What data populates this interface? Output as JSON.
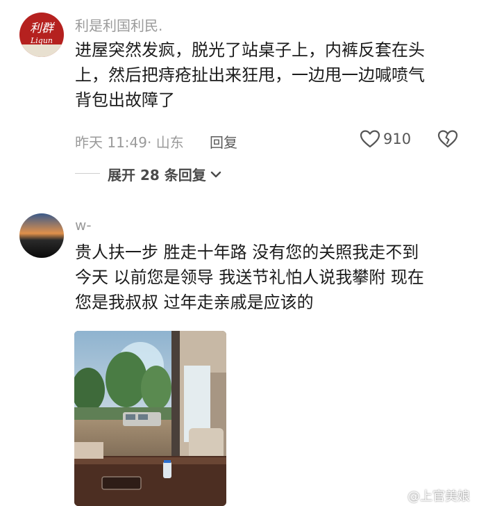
{
  "comments": [
    {
      "username": "利是利国利民.",
      "avatar_text": "利群",
      "avatar_subtext": "Liqun",
      "text_lines": [
        "进屋突然发疯，脱光了站桌子上，内裤反套在头",
        "上，然后把痔疮扯出来狂甩，一边甩一边喊喷气",
        "背包出故障了"
      ],
      "time_location": "昨天 11:49· 山东",
      "reply_label": "回复",
      "like_count": "910",
      "expand_label": "展开 28 条回复"
    },
    {
      "username": "w-",
      "text_lines": [
        "贵人扶一步 胜走十年路 没有您的关照我走不到",
        "今天 以前您是领导 我送节礼怕人说我攀附 现在",
        "您是我叔叔 过年走亲戚是应该的"
      ]
    }
  ],
  "watermark": "@上官美娘",
  "icons": {
    "like": "heart-outline-icon",
    "dislike": "broken-heart-icon",
    "expand": "chevron-down-icon",
    "weibo": "weibo-logo-icon"
  },
  "colors": {
    "accent_red": "#b5211f",
    "meta_gray": "#9a9a9a",
    "text_dark": "#1b1b1b"
  }
}
